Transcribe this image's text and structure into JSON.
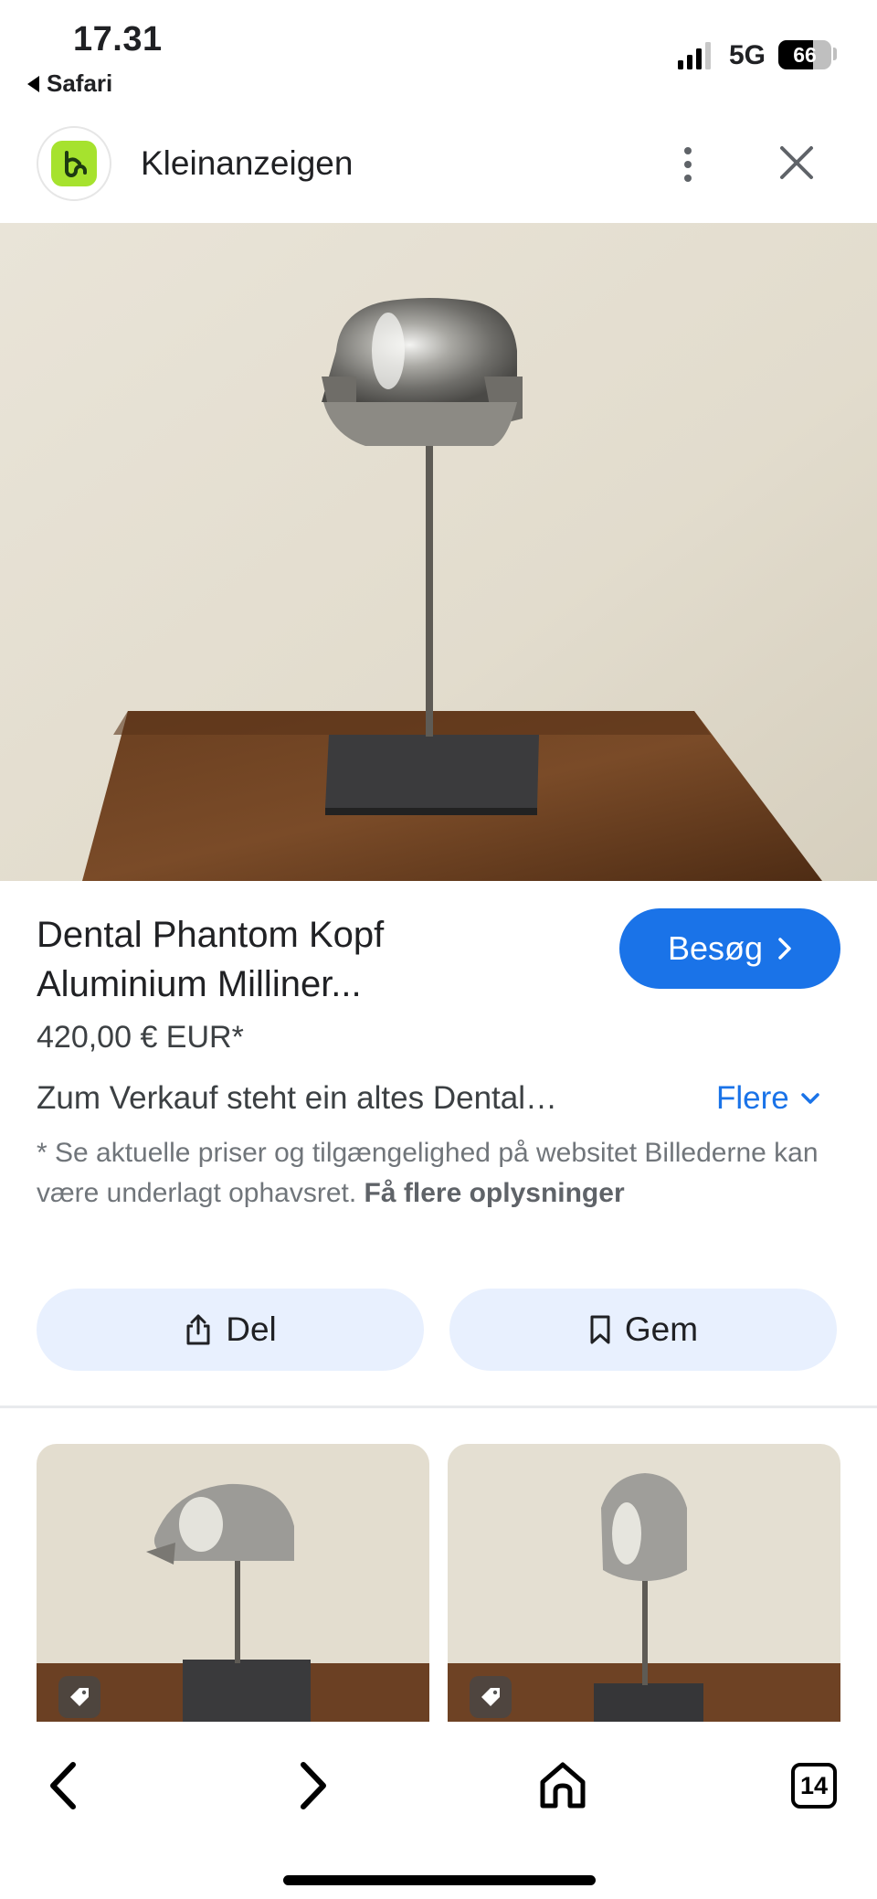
{
  "status_bar": {
    "time": "17.31",
    "back_app": "Safari",
    "network": "5G",
    "battery": "66",
    "battery_level": 0.66,
    "signal_bars": 3
  },
  "header": {
    "site_name": "Kleinanzeigen",
    "logo_icon": "kleinanzeigen-logo",
    "menu_icon": "more-vert-icon",
    "close_icon": "close-icon"
  },
  "product": {
    "title_line1": "Dental Phantom Kopf",
    "title_line2": "Aluminium Milliner...",
    "visit_label": "Besøg",
    "price": "420,00 € EUR*",
    "description": "Zum Verkauf steht ein altes Dental…",
    "more_label": "Flere",
    "note_text": "* Se aktuelle priser og tilgængelighed på websitet Billederne kan være underlagt ophavsret.",
    "note_link": "Få flere oplysninger"
  },
  "actions": {
    "share_label": "Del",
    "save_label": "Gem"
  },
  "toolbar": {
    "tabs_count": "14"
  },
  "colors": {
    "accent": "#1a73e8",
    "button_bg": "#e8f0fe",
    "logo": "#a6e22e"
  }
}
